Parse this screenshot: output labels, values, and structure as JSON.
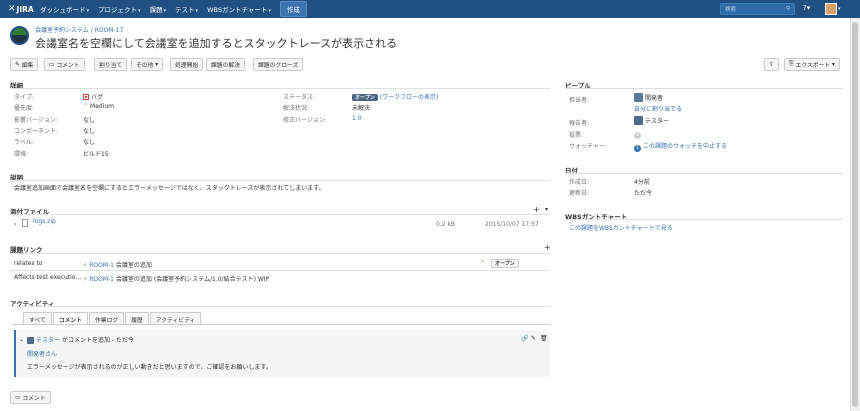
{
  "topbar": {
    "logo": "JIRA",
    "nav": [
      "ダッシュボード",
      "プロジェクト",
      "課題",
      "テスト",
      "WBSガントチャート"
    ],
    "create": "作成",
    "search_placeholder": "検索"
  },
  "issue": {
    "project": "会議室予約システム",
    "key": "ROOM-17",
    "summary": "会議室名を空欄にして会議室を追加するとスタックトレースが表示される"
  },
  "toolbar": {
    "edit": "編集",
    "comment": "コメント",
    "assign": "割り当て",
    "more": "その他",
    "start": "処理開始",
    "resolve": "課題の解決",
    "close": "課題のクローズ",
    "export": "エクスポート"
  },
  "details": {
    "heading": "詳細",
    "type_label": "タイプ:",
    "type": "バグ",
    "priority_label": "優先度:",
    "priority": "Medium",
    "affects_label": "影響バージョン:",
    "affects": "なし",
    "component_label": "コンポーネント:",
    "component": "なし",
    "labels_label": "ラベル:",
    "labels": "なし",
    "env_label": "環境:",
    "env": "ビルド15",
    "status_label": "ステータス:",
    "status": "オープン",
    "workflow": "(ワークフローの表示)",
    "resolution_label": "解決状況:",
    "resolution": "未解決",
    "fixver_label": "修正バージョン:",
    "fixver": "1.0"
  },
  "description": {
    "heading": "説明",
    "text": "会議室追加画面で会議室名を空欄にするとエラーメッセージではなく、スタックトレースが表示されてしまいます。"
  },
  "attachments": {
    "heading": "添付ファイル",
    "file": "logs.zip",
    "size": "0.2 kB",
    "date": "2015/10/07 17:57"
  },
  "links": {
    "heading": "課題リンク",
    "rows": [
      {
        "relation": "relates to",
        "key": "ROOM-1",
        "title": "会議室の追加",
        "status": "オープン"
      },
      {
        "relation": "Affects test executio...",
        "key": "ROOM-1",
        "title": "会議室の追加 (会議室予約システム/1.0/結合テスト) WIP"
      }
    ]
  },
  "activity": {
    "heading": "アクティビティ",
    "tabs": [
      "すべて",
      "コメント",
      "作業ログ",
      "履歴",
      "アクティビティ"
    ],
    "comment_header": "テスター がコメントを追加 - ただ今",
    "comment_author": "テスター",
    "comment_action": "がコメントを追加 - ただ今",
    "comment_to": "開発者さん",
    "comment_body": "エラーメッセージが表示されるのが正しい動きだと思いますので、ご確認をお願いします。",
    "comment_button": "コメント"
  },
  "people": {
    "heading": "ピープル",
    "assignee_label": "担当者:",
    "assignee": "開発者",
    "assign_me": "自分に割り当てる",
    "reporter_label": "報告者:",
    "reporter": "テスター",
    "votes_label": "投票:",
    "votes": "0",
    "watchers_label": "ウォッチャー:",
    "watchers": "1",
    "stop_watch": "この課題のウォッチを中止する"
  },
  "dates": {
    "heading": "日付",
    "created_label": "作成日:",
    "created": "4分前",
    "updated_label": "更新日:",
    "updated": "ただ今"
  },
  "wbs": {
    "heading": "WBSガントチャート",
    "link": "この課題をWBSガントチャートで見る"
  }
}
